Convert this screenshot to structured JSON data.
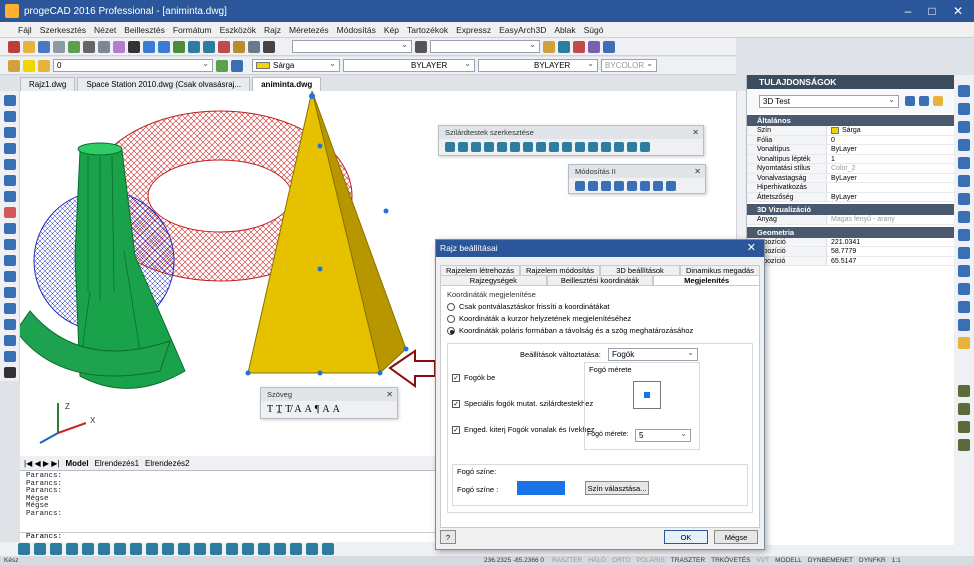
{
  "window": {
    "title": "progeCAD 2016 Professional - [animinta.dwg]"
  },
  "menu": [
    "Fájl",
    "Szerkesztés",
    "Nézet",
    "Beillesztés",
    "Formátum",
    "Eszközök",
    "Rajz",
    "Méretezés",
    "Módosítás",
    "Kép",
    "Tartozékok",
    "Expressz",
    "EasyArch3D",
    "Ablak",
    "Súgó"
  ],
  "toolbar": {
    "layer_value": "0",
    "color_value": "Sárga",
    "linetype_value": "BYLAYER",
    "lineweight_value": "BYLAYER",
    "plotstyle_value": "BYCOLOR"
  },
  "doc_tabs": [
    "Rajz1.dwg",
    "Space Station 2010.dwg (Csak olvasásraj...",
    "animinta.dwg"
  ],
  "layout_tabs": {
    "model": "Model",
    "layout1": "Elrendezés1",
    "layout2": "Elrendezés2"
  },
  "command_history": [
    "Parancs:",
    "Parancs:",
    "Parancs:",
    "Mégse",
    "Mégse",
    "Parancs:"
  ],
  "command_prompt": "Parancs:",
  "status": {
    "ready": "Kész",
    "coords": "236.2325 -85.2366 0",
    "toggles": [
      "RASZTER",
      "HÁLÓ",
      "ORTO",
      "POLÁRIS",
      "TRASZTER",
      "TRKÖVETÉS",
      "VVT",
      "MODELL",
      "DYNBEMENET",
      "DYNFKR"
    ],
    "scale": "1:1"
  },
  "axis": {
    "z": "Z",
    "x": "X"
  },
  "palettes": {
    "solid_edit": "Szilárdtestek szerkesztése",
    "modify2": "Módosítás II",
    "text": "Szöveg",
    "text_tools": [
      "T",
      "T̲",
      "T̸",
      "A",
      "A",
      "¶",
      "A",
      "A"
    ]
  },
  "properties": {
    "title": "TULAJDONSÁGOK",
    "selection": "3D Test",
    "groups": [
      {
        "name": "Általános",
        "rows": [
          [
            "Szín",
            "Sárga"
          ],
          [
            "Fólia",
            "0"
          ],
          [
            "Vonaltípus",
            "ByLayer"
          ],
          [
            "Vonaltípus lépték",
            "1"
          ],
          [
            "Nyomtatási stílus",
            "Color_2"
          ],
          [
            "Vonalvastagság",
            "ByLayer"
          ],
          [
            "Hiperhivatkozás",
            ""
          ],
          [
            "Áttetszőség",
            "ByLayer"
          ]
        ]
      },
      {
        "name": "3D Vizualizáció",
        "rows": [
          [
            "Anyag",
            "Magas fényű - arany"
          ]
        ]
      },
      {
        "name": "Geometria",
        "rows": [
          [
            "X pozíció",
            "221.0341"
          ],
          [
            "Y pozíció",
            "58.7779"
          ],
          [
            "Z pozíció",
            "65.5147"
          ]
        ]
      }
    ],
    "yellow": "#f2d600"
  },
  "dialog": {
    "title": "Rajz beállításai",
    "tabs_row1": [
      "Rajzelem létrehozás",
      "Rajzelem módosítás",
      "3D beállítások",
      "Dinamikus megadás"
    ],
    "tabs_row2": [
      "Rajzegységek",
      "Beillesztési koordináták",
      "Megjelenítés"
    ],
    "section_coords": "Koordináták megjelenítése",
    "radio1": "Csak pontválasztáskor frissíti a koordinátákat",
    "radio2": "Koordináták a kurzor helyzetének megjelenítéséhez",
    "radio3": "Koordináták poláris formában a távolság és a szög meghatározásához",
    "change_label": "Beállítások változtatása:",
    "change_value": "Fogók",
    "grip_on": "Fogók be",
    "grip_special": "Speciális fogók mutat. szilárdtestekhez",
    "grip_lines": "Enged. kiterj Fogók vonalak és ívekhez",
    "grip_size_box": "Fogó mérete",
    "grip_size_label": "Fogó mérete:",
    "grip_size_value": "5",
    "grip_color_section": "Fogó színe:",
    "grip_color_label": "Fogó színe :",
    "color_button": "Szín választása...",
    "ok": "OK",
    "cancel": "Mégse",
    "help": "?",
    "grip_color": "#1a73e8"
  }
}
